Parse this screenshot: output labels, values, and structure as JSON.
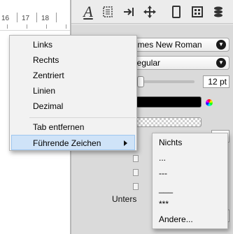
{
  "ruler": {
    "numbers": [
      "16",
      "17",
      "18"
    ]
  },
  "toolbar": {
    "icons": [
      "text-style-icon",
      "paragraph-icon",
      "tab-icon",
      "move-icon",
      "page-icon",
      "pattern-icon",
      "layers-icon"
    ]
  },
  "inspector": {
    "font_family": "Times New Roman",
    "font_style": "Regular",
    "font_size": "12 pt",
    "underline_label": "Unters"
  },
  "context_menu": {
    "items": [
      "Links",
      "Rechts",
      "Zentriert",
      "Linien",
      "Dezimal"
    ],
    "remove_tab": "Tab entfernen",
    "leader": "Führende Zeichen"
  },
  "leader_submenu": {
    "items": [
      "Nichts",
      "...",
      "---",
      "___",
      "***",
      "Andere..."
    ]
  },
  "colors": {
    "menu_bg": "#f2f2f2",
    "highlight": "#cfe3f8",
    "panel": "#dadada"
  }
}
